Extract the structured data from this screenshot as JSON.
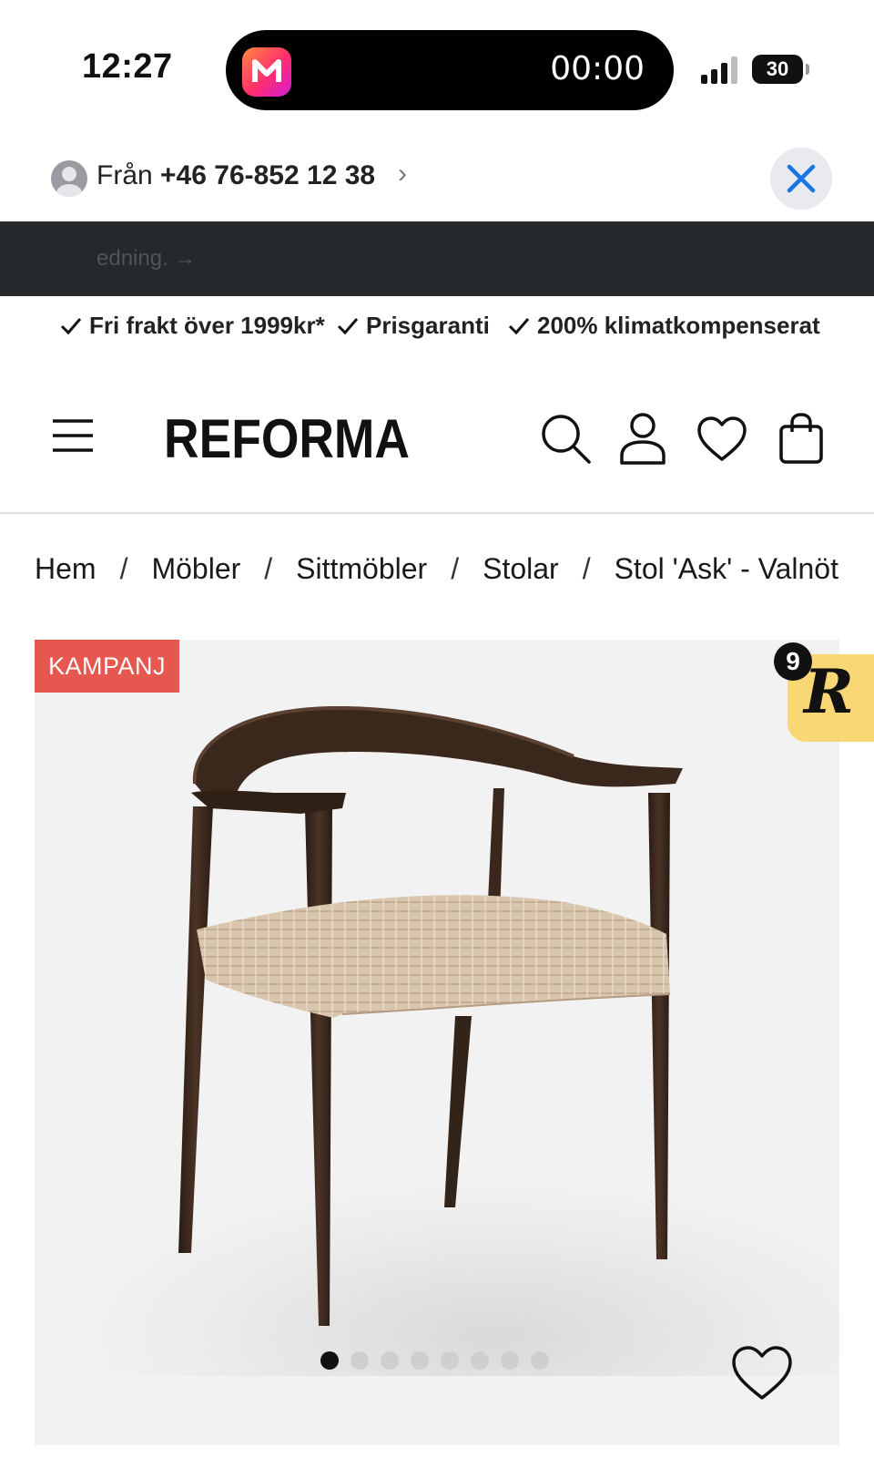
{
  "status_bar": {
    "time": "12:27",
    "live_activity_timer": "00:00",
    "battery": "30"
  },
  "call_header": {
    "from_label": "Från",
    "phone_number": "+46 76-852 12 38"
  },
  "banner": {
    "text": "edning. →"
  },
  "usps": [
    "Fri frakt över 1999kr*",
    "Prisgaranti",
    "200% klimatkompenserat"
  ],
  "header": {
    "logo": "REFORMA"
  },
  "breadcrumb": [
    "Hem",
    "Möbler",
    "Sittmöbler",
    "Stolar",
    "Stol 'Ask' - Valnöt"
  ],
  "product": {
    "badge": "KAMPANJ",
    "image_count": 8,
    "active_image": 1
  },
  "r_widget": {
    "letter": "R",
    "count": "9"
  },
  "colors": {
    "banner_bg": "#25292b",
    "badge_bg": "#e5574f",
    "widget_bg": "#f9d774",
    "close_icon": "#1a73e8"
  },
  "icons": {
    "header": [
      "menu-icon",
      "search-icon",
      "user-icon",
      "heart-icon",
      "shopping-bag-icon"
    ],
    "call": [
      "person-icon",
      "close-icon"
    ]
  }
}
